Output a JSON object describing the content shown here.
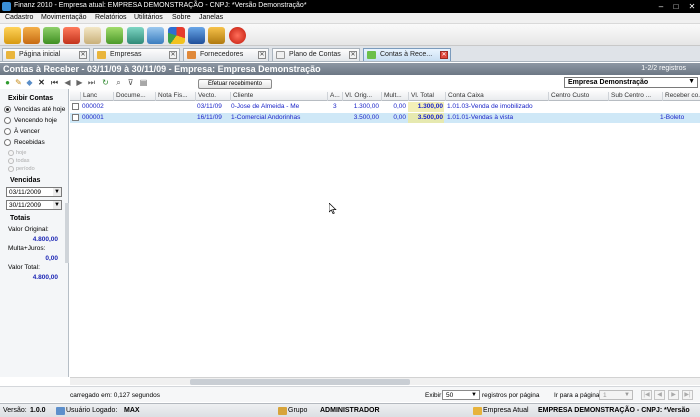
{
  "window": {
    "title": "Finanz 2010 - Empresa atual: EMPRESA DEMONSTRAÇÃO - CNPJ: *Versão Demonstração*",
    "controls": [
      "–",
      "□",
      "✕"
    ]
  },
  "menu": [
    "Cadastro",
    "Movimentação",
    "Relatórios",
    "Utilitários",
    "Sobre",
    "Janelas"
  ],
  "tabs": [
    {
      "label": "Página inicial",
      "active": false
    },
    {
      "label": "Empresas",
      "active": false
    },
    {
      "label": "Fornecedores",
      "active": false
    },
    {
      "label": "Plano de Contas",
      "active": false
    },
    {
      "label": "Contas à Rece...",
      "active": true
    }
  ],
  "header": {
    "title": "Contas à Receber - 03/11/09 à 30/11/09   -  Empresa: Empresa Demonstração",
    "count": "1-2/2 registros"
  },
  "actions": {
    "efetuar_label": "Efetuar recebimento"
  },
  "empresa_select": {
    "value": "Empresa Demonstração"
  },
  "left_panel": {
    "exibir_title": "Exibir Contas",
    "options": [
      {
        "label": "Vencidas até hoje",
        "selected": true
      },
      {
        "label": "Vencendo hoje",
        "selected": false
      },
      {
        "label": "À vencer",
        "selected": false
      },
      {
        "label": "Recebidas",
        "selected": false
      }
    ],
    "sub_options": [
      "hoje",
      "todas",
      "período"
    ],
    "vencidas_title": "Vencidas",
    "date_from": "03/11/2009",
    "date_to": "30/11/2009",
    "totais_title": "Totais",
    "valor_original_label": "Valor Original:",
    "valor_original": "4.800,00",
    "multa_juros_label": "Multa+Juros:",
    "multa_juros": "0,00",
    "valor_total_label": "Valor Total:",
    "valor_total": "4.800,00"
  },
  "grid": {
    "columns": [
      "Lanc",
      "Docume...",
      "Nota Fis...",
      "Vecto.",
      "Cliente",
      "A...",
      "Vl. Orig...",
      "Mult...",
      "Vl. Total",
      "Conta Caixa",
      "Centro Custo",
      "Sub Centro ...",
      "Receber co..."
    ],
    "rows": [
      {
        "lanc": "000002",
        "doc": "",
        "nota": "",
        "vecto": "03/11/09",
        "cliente": "0-Jose de Almeida - Me",
        "a": "3",
        "orig": "1.300,00",
        "mult": "0,00",
        "total": "1.300,00",
        "conta": "1.01.03-Venda de imobilizado",
        "centro": "",
        "sub": "",
        "receber": "",
        "selected": false
      },
      {
        "lanc": "000001",
        "doc": "",
        "nota": "",
        "vecto": "16/11/09",
        "cliente": "1-Comercial Andorinhas",
        "a": "",
        "orig": "3.500,00",
        "mult": "0,00",
        "total": "3.500,00",
        "conta": "1.01.01-Vendas à vista",
        "centro": "",
        "sub": "",
        "receber": "1-Boleto",
        "selected": true
      }
    ]
  },
  "pager": {
    "loaded": "carregado em: 0,127 segundos",
    "exibir_label": "Exibir",
    "per_page": "50",
    "per_page_label": "registros por página",
    "goto_label": "Ir para a página",
    "page": "1"
  },
  "status": {
    "versao_label": "Versão:",
    "versao": "1.0.0",
    "usuario_label": "Usuário Logado:",
    "usuario": "MAX",
    "grupo_label": "Grupo",
    "grupo": "ADMINISTRADOR",
    "empresa_label": "Empresa Atual",
    "empresa": "EMPRESA DEMONSTRAÇÃO - CNPJ:",
    "versao_tag": "*Versão"
  },
  "colors": {
    "header_band": "#7a8592",
    "link_blue": "#1a24c8",
    "selected_row": "#cfe8f7",
    "total_highlight": "#f3efb8"
  },
  "icons": [
    "app-icon",
    "add-icon",
    "edit-icon",
    "delete-icon",
    "refresh-icon",
    "search-icon",
    "filter-icon",
    "print-icon",
    "close-icon",
    "chevron-down-icon"
  ]
}
